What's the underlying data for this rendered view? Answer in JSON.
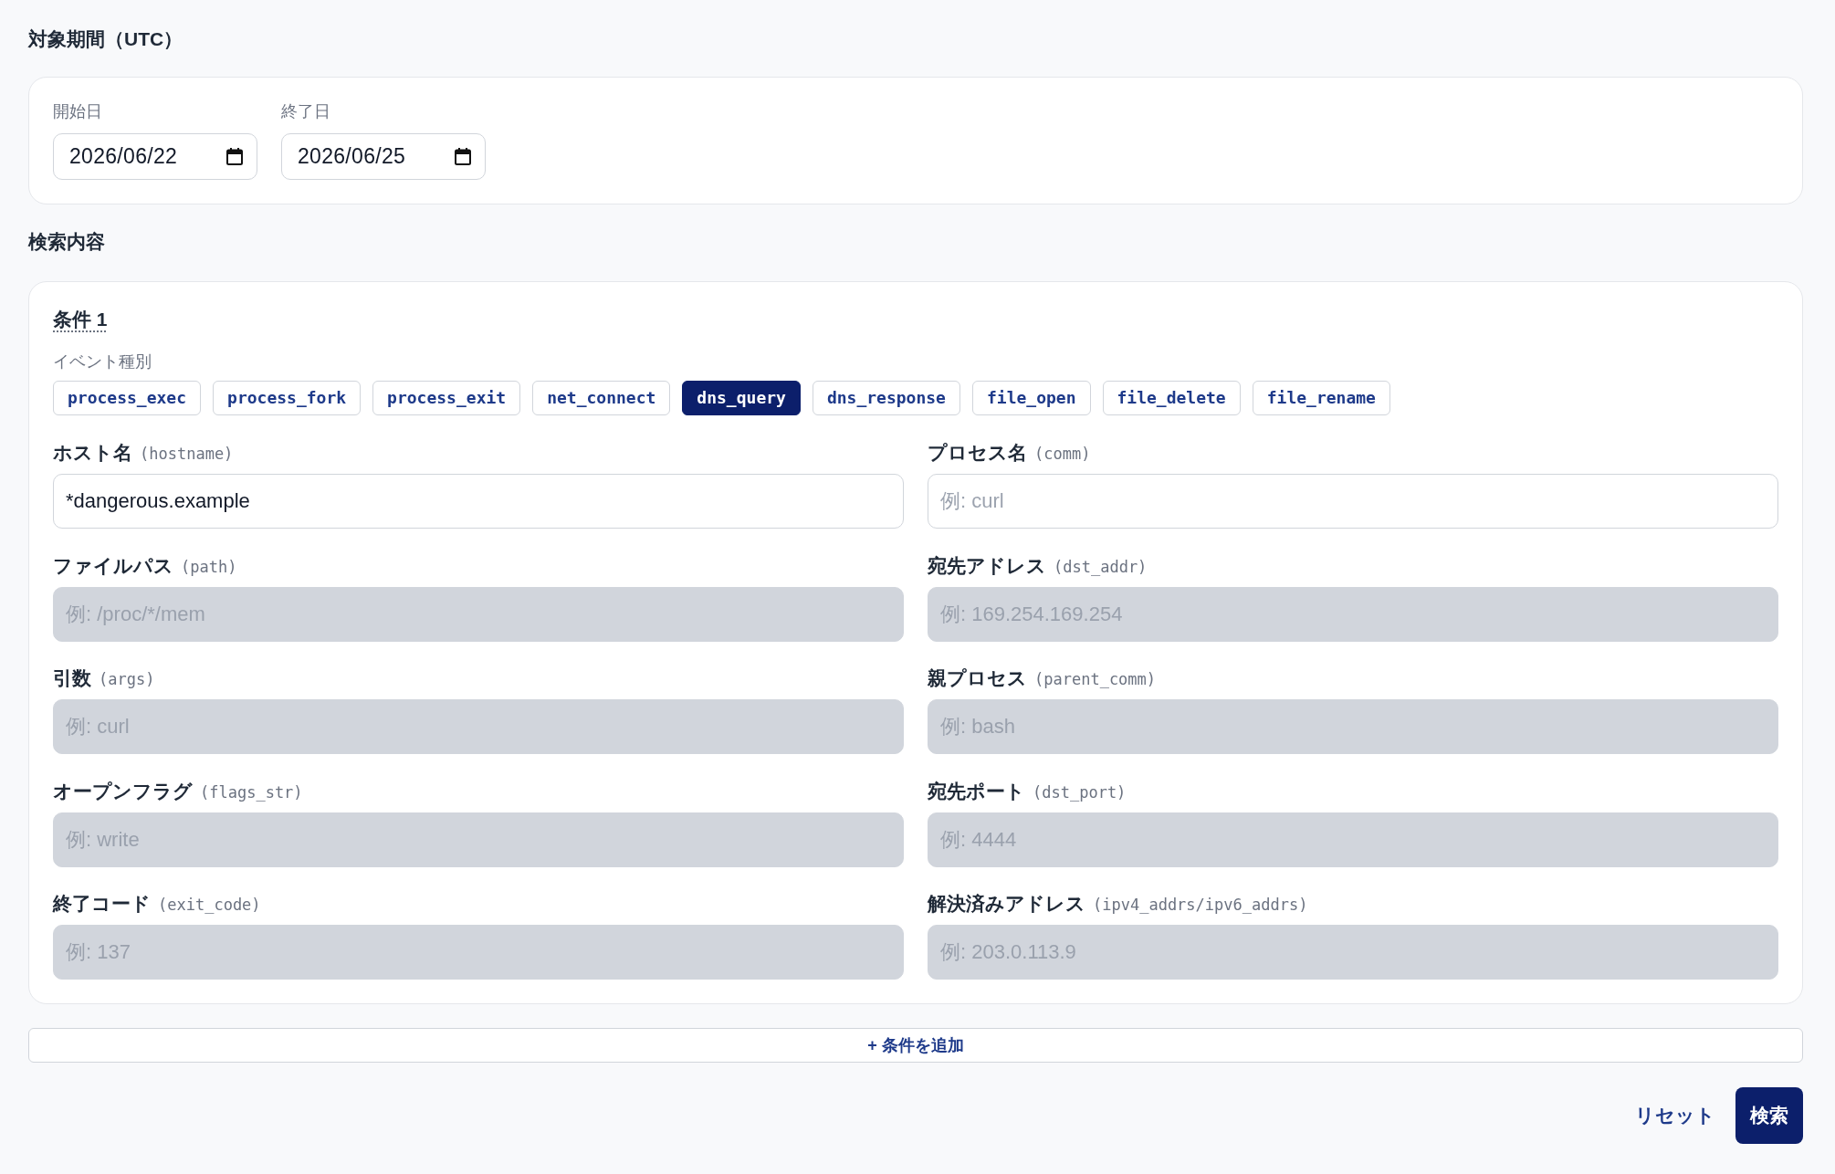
{
  "period": {
    "title": "対象期間（UTC）",
    "fields": [
      {
        "label": "開始日",
        "value": "2026/06/22"
      },
      {
        "label": "終了日",
        "value": "2026/06/25"
      }
    ]
  },
  "search": {
    "title": "検索内容",
    "conditions": [
      {
        "title": "条件 1",
        "event_type_label": "イベント種別",
        "event_types": [
          {
            "label": "process_exec",
            "selected": false
          },
          {
            "label": "process_fork",
            "selected": false
          },
          {
            "label": "process_exit",
            "selected": false
          },
          {
            "label": "net_connect",
            "selected": false
          },
          {
            "label": "dns_query",
            "selected": true
          },
          {
            "label": "dns_response",
            "selected": false
          },
          {
            "label": "file_open",
            "selected": false
          },
          {
            "label": "file_delete",
            "selected": false
          },
          {
            "label": "file_rename",
            "selected": false
          }
        ],
        "fields": [
          {
            "label": "ホスト名",
            "key": "(hostname)",
            "value": "*dangerous.example",
            "disabled": false
          },
          {
            "label": "プロセス名",
            "key": "(comm)",
            "placeholder": "例: curl",
            "disabled": false
          },
          {
            "label": "ファイルパス",
            "key": "(path)",
            "placeholder": "例: /proc/*/mem",
            "disabled": true
          },
          {
            "label": "宛先アドレス",
            "key": "(dst_addr)",
            "placeholder": "例: 169.254.169.254",
            "disabled": true
          },
          {
            "label": "引数",
            "key": "(args)",
            "placeholder": "例: curl",
            "disabled": true
          },
          {
            "label": "親プロセス",
            "key": "(parent_comm)",
            "placeholder": "例: bash",
            "disabled": true
          },
          {
            "label": "オープンフラグ",
            "key": "(flags_str)",
            "placeholder": "例: write",
            "disabled": true
          },
          {
            "label": "宛先ポート",
            "key": "(dst_port)",
            "placeholder": "例: 4444",
            "disabled": true
          },
          {
            "label": "終了コード",
            "key": "(exit_code)",
            "placeholder": "例: 137",
            "disabled": true
          },
          {
            "label": "解決済みアドレス",
            "key": "(ipv4_addrs/ipv6_addrs)",
            "placeholder": "例: 203.0.113.9",
            "disabled": true
          }
        ]
      }
    ],
    "add_button": "+ 条件を追加"
  },
  "buttons": [
    {
      "label": "リセット",
      "kind": "link"
    },
    {
      "label": "検索",
      "kind": "primary"
    }
  ]
}
